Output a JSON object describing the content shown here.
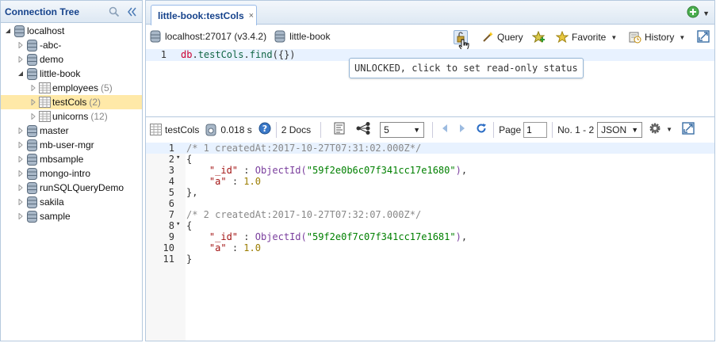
{
  "tree": {
    "title": "Connection Tree",
    "items": [
      {
        "label": "localhost",
        "count": "",
        "level": 0,
        "type": "server",
        "expanded": true,
        "selected": false
      },
      {
        "label": "-abc-",
        "count": "",
        "level": 1,
        "type": "db",
        "expanded": false,
        "selected": false
      },
      {
        "label": "demo",
        "count": "",
        "level": 1,
        "type": "db",
        "expanded": false,
        "selected": false
      },
      {
        "label": "little-book",
        "count": "",
        "level": 1,
        "type": "db",
        "expanded": true,
        "selected": false
      },
      {
        "label": "employees",
        "count": "(5)",
        "level": 2,
        "type": "collection",
        "expanded": false,
        "selected": false
      },
      {
        "label": "testCols",
        "count": "(2)",
        "level": 2,
        "type": "collection",
        "expanded": false,
        "selected": true
      },
      {
        "label": "unicorns",
        "count": "(12)",
        "level": 2,
        "type": "collection",
        "expanded": false,
        "selected": false
      },
      {
        "label": "master",
        "count": "",
        "level": 1,
        "type": "db",
        "expanded": false,
        "selected": false
      },
      {
        "label": "mb-user-mgr",
        "count": "",
        "level": 1,
        "type": "db",
        "expanded": false,
        "selected": false
      },
      {
        "label": "mbsample",
        "count": "",
        "level": 1,
        "type": "db",
        "expanded": false,
        "selected": false
      },
      {
        "label": "mongo-intro",
        "count": "",
        "level": 1,
        "type": "db",
        "expanded": false,
        "selected": false
      },
      {
        "label": "runSQLQueryDemo",
        "count": "",
        "level": 1,
        "type": "db",
        "expanded": false,
        "selected": false
      },
      {
        "label": "sakila",
        "count": "",
        "level": 1,
        "type": "db",
        "expanded": false,
        "selected": false
      },
      {
        "label": "sample",
        "count": "",
        "level": 1,
        "type": "db",
        "expanded": false,
        "selected": false
      }
    ]
  },
  "tab": {
    "label": "little-book:testCols",
    "close": "×"
  },
  "toolbar": {
    "server": "localhost:27017 (v3.4.2)",
    "database": "little-book",
    "query": "Query",
    "favorite": "Favorite",
    "history": "History"
  },
  "editor": {
    "line_number": "1",
    "code_db": "db",
    "code_dot1": ".",
    "code_coll": "testCols",
    "code_dot2": ".",
    "code_fn": "find",
    "code_args": "({})"
  },
  "tooltip": "UNLOCKED, click to set read-only status",
  "results_toolbar": {
    "collection": "testCols",
    "time": "0.018 s",
    "docs": "2 Docs",
    "page_size": "5",
    "page_label": "Page",
    "page_value": "1",
    "range": "No. 1 - 2",
    "format": "JSON"
  },
  "results": [
    {
      "n": "1",
      "fold": "",
      "parts": [
        [
          "c-comment",
          "/* 1 createdAt:2017-10-27T07:31:02.000Z*/"
        ]
      ]
    },
    {
      "n": "2",
      "fold": "▾",
      "parts": [
        [
          "c-punc",
          "{"
        ]
      ]
    },
    {
      "n": "3",
      "fold": "",
      "parts": [
        [
          "c-punc",
          "    "
        ],
        [
          "c-key",
          "\"_id\""
        ],
        [
          "c-punc",
          " : "
        ],
        [
          "c-oid",
          "ObjectId("
        ],
        [
          "c-str",
          "\"59f2e0b6c07f341cc17e1680\""
        ],
        [
          "c-oid",
          ")"
        ],
        [
          "c-punc",
          ","
        ]
      ]
    },
    {
      "n": "4",
      "fold": "",
      "parts": [
        [
          "c-punc",
          "    "
        ],
        [
          "c-key",
          "\"a\""
        ],
        [
          "c-punc",
          " : "
        ],
        [
          "c-num",
          "1.0"
        ]
      ]
    },
    {
      "n": "5",
      "fold": "",
      "parts": [
        [
          "c-punc",
          "},"
        ]
      ]
    },
    {
      "n": "6",
      "fold": "",
      "parts": [
        [
          "c-punc",
          ""
        ]
      ]
    },
    {
      "n": "7",
      "fold": "",
      "parts": [
        [
          "c-comment",
          "/* 2 createdAt:2017-10-27T07:32:07.000Z*/"
        ]
      ]
    },
    {
      "n": "8",
      "fold": "▾",
      "parts": [
        [
          "c-punc",
          "{"
        ]
      ]
    },
    {
      "n": "9",
      "fold": "",
      "parts": [
        [
          "c-punc",
          "    "
        ],
        [
          "c-key",
          "\"_id\""
        ],
        [
          "c-punc",
          " : "
        ],
        [
          "c-oid",
          "ObjectId("
        ],
        [
          "c-str",
          "\"59f2e0f7c07f341cc17e1681\""
        ],
        [
          "c-oid",
          ")"
        ],
        [
          "c-punc",
          ","
        ]
      ]
    },
    {
      "n": "10",
      "fold": "",
      "parts": [
        [
          "c-punc",
          "    "
        ],
        [
          "c-key",
          "\"a\""
        ],
        [
          "c-punc",
          " : "
        ],
        [
          "c-num",
          "1.0"
        ]
      ]
    },
    {
      "n": "11",
      "fold": "",
      "parts": [
        [
          "c-punc",
          "}"
        ]
      ]
    }
  ],
  "colors": {
    "selected_row": "#ffe9a8",
    "header_text": "#15428b",
    "border": "#b5c9de",
    "line_highlight": "#e8f2ff"
  }
}
